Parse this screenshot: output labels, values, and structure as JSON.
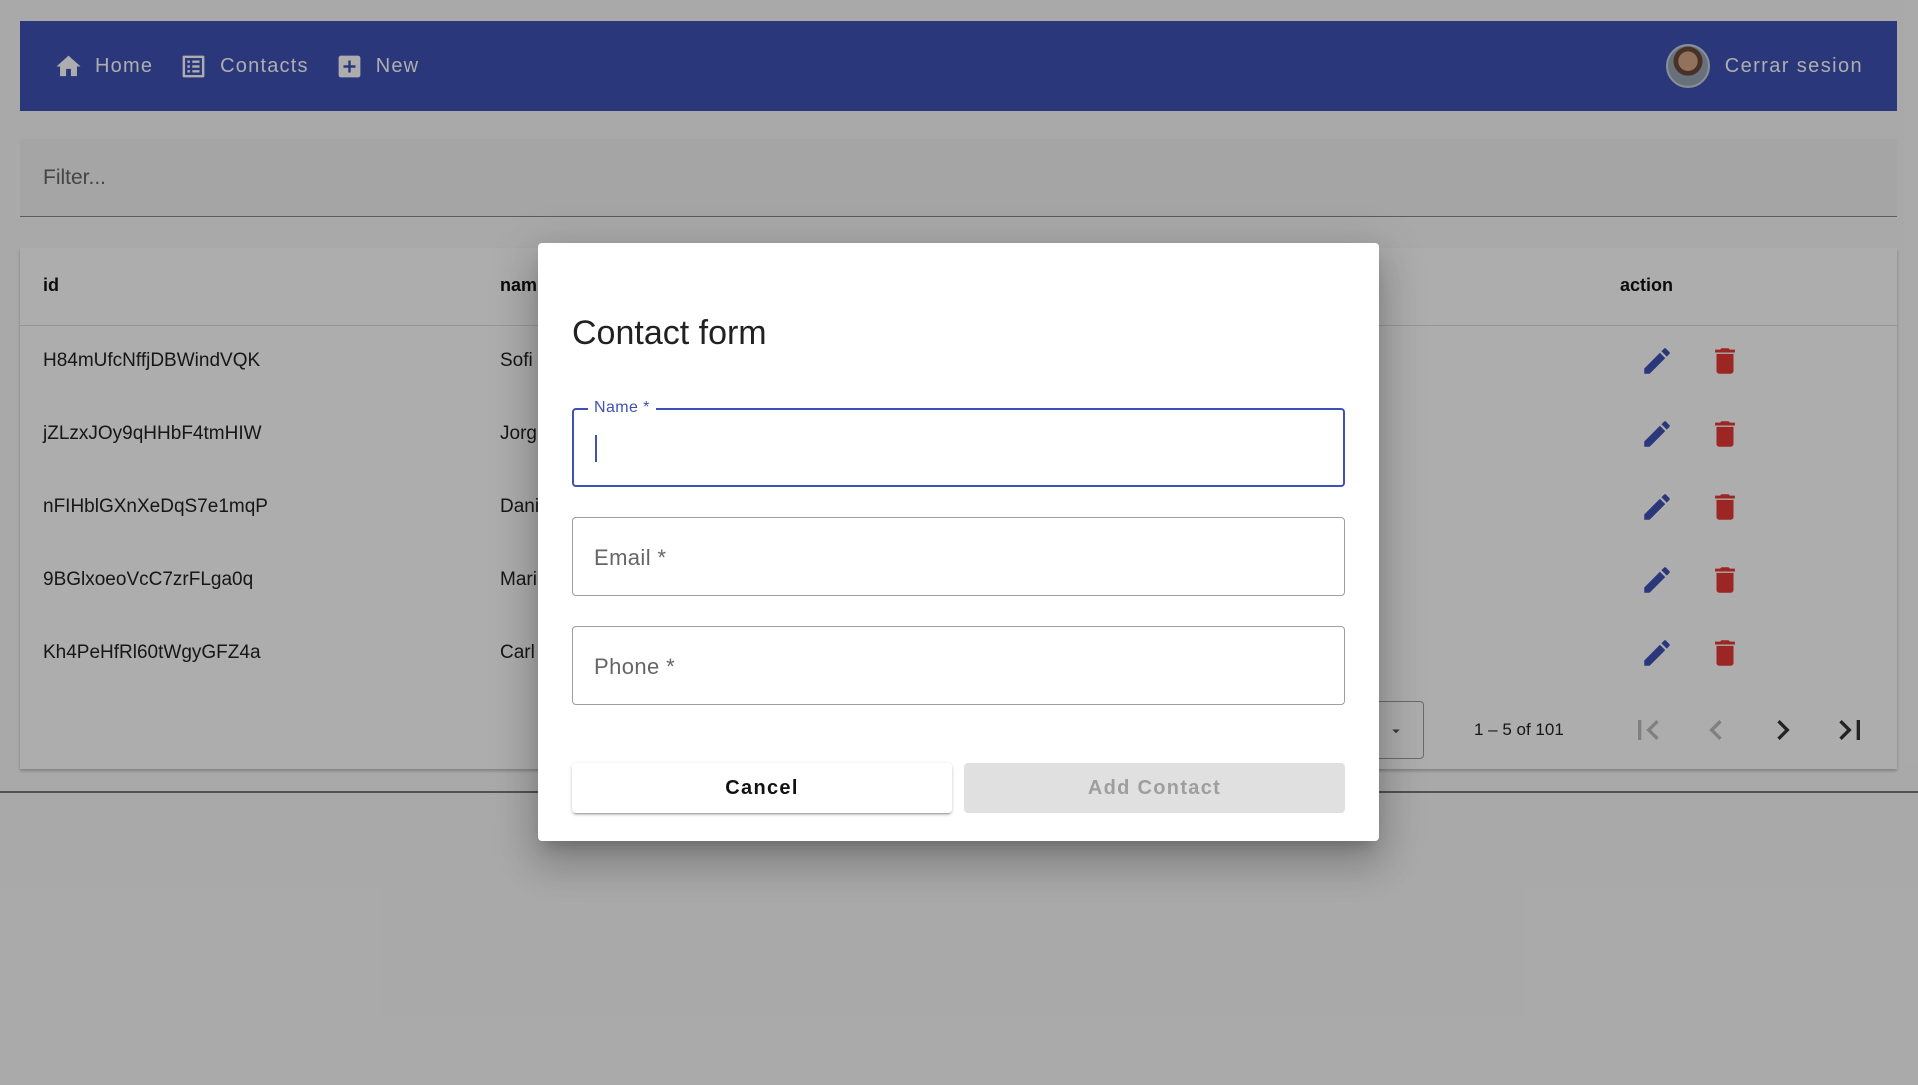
{
  "toolbar": {
    "nav": [
      {
        "label": "Home",
        "icon": "home-icon"
      },
      {
        "label": "Contacts",
        "icon": "list-icon"
      },
      {
        "label": "New",
        "icon": "add-box-icon"
      }
    ],
    "logout_label": "Cerrar sesion",
    "color": "#3f51b5"
  },
  "filter": {
    "placeholder": "Filter..."
  },
  "table": {
    "headers": {
      "id": "id",
      "name": "nam",
      "action": "action"
    },
    "rows": [
      {
        "id": "H84mUfcNffjDBWindVQK",
        "name": "Sofi"
      },
      {
        "id": "jZLzxJOy9qHHbF4tmHIW",
        "name": "Jorg"
      },
      {
        "id": "nFIHblGXnXeDqS7e1mqP",
        "name": "Dani"
      },
      {
        "id": "9BGlxoeoVcC7zrFLga0q",
        "name": "Mari"
      },
      {
        "id": "Kh4PeHfRl60tWgyGFZ4a",
        "name": "Carl"
      }
    ],
    "edit_color": "#3f51b5",
    "delete_color": "#e53935"
  },
  "paginator": {
    "range_label": "1 – 5 of 101"
  },
  "dialog": {
    "title": "Contact form",
    "fields": {
      "name": {
        "label": "Name *",
        "value": ""
      },
      "email": {
        "label": "Email *",
        "value": ""
      },
      "phone": {
        "label": "Phone *",
        "value": ""
      }
    },
    "cancel_label": "Cancel",
    "submit_label": "Add Contact"
  }
}
